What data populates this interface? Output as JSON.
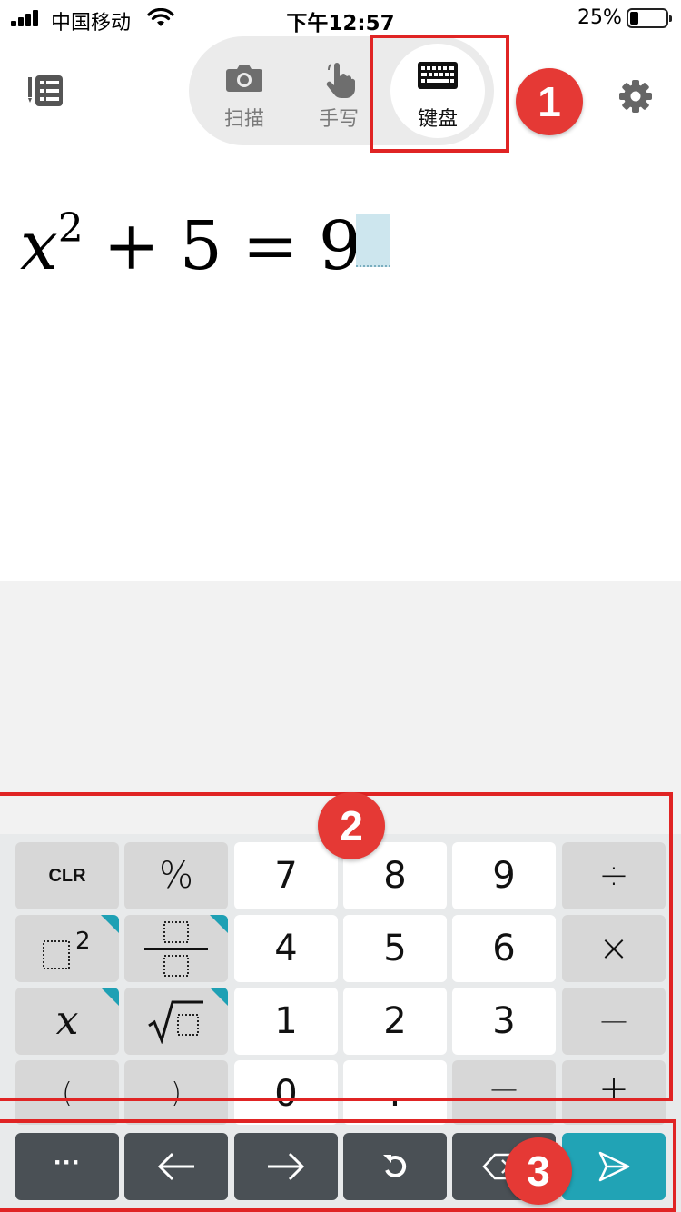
{
  "status_bar": {
    "carrier": "中国移动",
    "time": "下午12:57",
    "battery_percent": "25%"
  },
  "header": {
    "icons": {
      "history": "list-icon",
      "settings": "gear-icon"
    },
    "modes": [
      {
        "label": "扫描",
        "icon": "camera-icon",
        "active": false
      },
      {
        "label": "手写",
        "icon": "hand-pointer-icon",
        "active": false
      },
      {
        "label": "键盘",
        "icon": "keyboard-icon",
        "active": true
      }
    ]
  },
  "annotations": {
    "badge_1": "1",
    "badge_2": "2",
    "badge_3": "3",
    "color": "#e02424"
  },
  "expression": {
    "base": "x",
    "exponent": "2",
    "plus": "+",
    "addend": "5",
    "equals": "=",
    "result": "9"
  },
  "keypad": {
    "row1": [
      "CLR",
      "%",
      "7",
      "8",
      "9",
      "÷"
    ],
    "row2": [
      "□²",
      "□/□",
      "4",
      "5",
      "6",
      "×"
    ],
    "row3": [
      "x",
      "√□",
      "1",
      "2",
      "3",
      "—"
    ],
    "row4": [
      "(",
      ")",
      "0",
      ".",
      "—",
      "+"
    ],
    "clr": "CLR",
    "percent": "%",
    "divide": "÷",
    "times": "×",
    "minus": "—",
    "plus": "+",
    "var_x": "x",
    "square_exp": "2",
    "lparen": "(",
    "rparen": ")",
    "dot": ".",
    "digits": {
      "d0": "0",
      "d1": "1",
      "d2": "2",
      "d3": "3",
      "d4": "4",
      "d5": "5",
      "d6": "6",
      "d7": "7",
      "d8": "8",
      "d9": "9"
    }
  },
  "bottom_bar": {
    "more": "···",
    "icons": [
      "left-arrow-icon",
      "right-arrow-icon",
      "undo-icon",
      "backspace-icon",
      "send-icon"
    ]
  },
  "colors": {
    "accent_teal": "#21a3b5",
    "dark_key": "#4a5055",
    "cursor": "#cde6ee"
  }
}
